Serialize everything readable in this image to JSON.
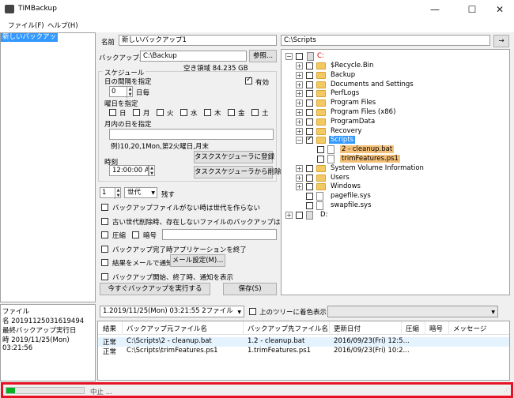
{
  "window": {
    "title": "TIMBackup",
    "minimize": "—",
    "maximize": "☐",
    "close": "✕"
  },
  "menu": [
    {
      "label": "ファイル(F)"
    },
    {
      "label": "ヘルプ(H)"
    }
  ],
  "backup_list": {
    "items": [
      {
        "label": "新しいバックアップ1"
      }
    ]
  },
  "info": {
    "line1": "ファイル",
    "line2": "名 20191125031619494",
    "line3": "最終バックアップ実行日",
    "line4": "時 2019/11/25(Mon)",
    "line5": "03:21:56"
  },
  "settings": {
    "name_label": "名前",
    "name_value": "新しいバックアップ1",
    "dest_label": "バックアップ先",
    "dest_value": "C:\\Backup",
    "browse": "参照...",
    "free_space": "空き領域 84.235 GB",
    "schedule_title": "スケジュール",
    "interval_label": "日の間隔を指定",
    "enabled_label": "有効",
    "interval_value": "0",
    "interval_unit": "日毎",
    "weekday_label": "曜日を指定",
    "days": [
      "日",
      "月",
      "火",
      "水",
      "木",
      "金",
      "土"
    ],
    "monthday_label": "月内の日を指定",
    "example": "例)10,20,1Mon,第2火曜日,月末",
    "time_label": "時刻",
    "time_value": "12:00:00 AM",
    "register": "タスクスケジューラに登録",
    "unregister": "タスクスケジューラから削除",
    "gen_value": "1",
    "gen_select": "世代",
    "gen_suffix": "残す",
    "opt1": "バックアップファイルがない時は世代を作らない",
    "opt2": "古い世代削除時、存在しないファイルのバックアップは削除",
    "compress": "圧縮",
    "encrypt": "暗号",
    "opt4": "バックアップ完了時アプリケーションを終了",
    "opt5": "結果をメールで通知",
    "mail_settings": "メール設定(M)...",
    "opt6": "バックアップ開始、終了時、通知を表示",
    "run_now": "今すぐバックアップを実行する",
    "save": "保存(S)"
  },
  "tree": {
    "path": "C:\\Scripts",
    "go": "→",
    "nodes": [
      {
        "label": "C:",
        "exp": "−"
      },
      {
        "label": "$Recycle.Bin",
        "exp": "+"
      },
      {
        "label": "Backup",
        "exp": "+"
      },
      {
        "label": "Documents and Settings",
        "exp": "+"
      },
      {
        "label": "PerfLogs",
        "exp": "+"
      },
      {
        "label": "Program Files",
        "exp": "+"
      },
      {
        "label": "Program Files (x86)",
        "exp": "+"
      },
      {
        "label": "ProgramData",
        "exp": "+"
      },
      {
        "label": "Recovery",
        "exp": "+"
      },
      {
        "label": "Scripts",
        "exp": "−"
      },
      {
        "label": "2 - cleanup.bat",
        "exp": ""
      },
      {
        "label": "trimFeatures.ps1",
        "exp": ""
      },
      {
        "label": "System Volume Information",
        "exp": "+"
      },
      {
        "label": "Users",
        "exp": "+"
      },
      {
        "label": "Windows",
        "exp": "+"
      },
      {
        "label": "pagefile.sys",
        "exp": ""
      },
      {
        "label": "swapfile.sys",
        "exp": ""
      },
      {
        "label": "D:",
        "exp": "+"
      }
    ]
  },
  "results": {
    "generation": "1.2019/11/25(Mon) 03:21:55 2ファイル",
    "color_label": "上のツリーに着色表示",
    "headers": [
      "結果",
      "バックアップ元ファイル名",
      "バックアップ先ファイル名",
      "更新日付",
      "圧縮",
      "暗号",
      "メッセージ"
    ],
    "rows": [
      [
        "正常",
        "C:\\Scripts\\2 - cleanup.bat",
        "1.2 - cleanup.bat",
        "2016/09/23(Fri) 12:5..."
      ],
      [
        "正常",
        "C:\\Scripts\\trimFeatures.ps1",
        "1.trimFeatures.ps1",
        "2016/09/23(Fri) 10:2..."
      ]
    ]
  },
  "status": {
    "text": "中止 ...",
    "progress": 0.11,
    "colors": {
      "progress": "#06b025",
      "frame": "#e81123"
    }
  }
}
